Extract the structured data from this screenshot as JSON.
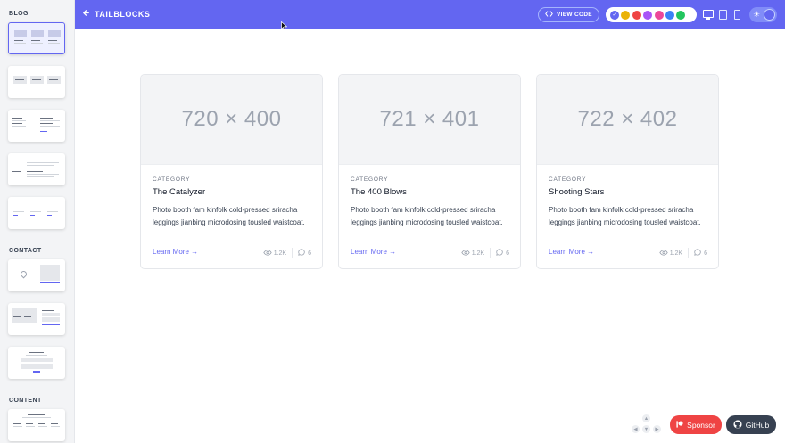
{
  "sidebar": {
    "sections": [
      {
        "title": "BLOG"
      },
      {
        "title": "CONTACT"
      },
      {
        "title": "CONTENT"
      }
    ]
  },
  "header": {
    "brand": "TAILBLOCKS",
    "view_code_label": "VIEW CODE",
    "colors": [
      "#6366f1",
      "#eab308",
      "#ef4444",
      "#a855f7",
      "#ec4899",
      "#3b82f6",
      "#22c55e"
    ]
  },
  "cards": [
    {
      "image_label": "720 × 400",
      "category": "CATEGORY",
      "title": "The Catalyzer",
      "desc": "Photo booth fam kinfolk cold-pressed sriracha leggings jianbing microdosing tousled waistcoat.",
      "link": "Learn More",
      "views": "1.2K",
      "comments": "6"
    },
    {
      "image_label": "721 × 401",
      "category": "CATEGORY",
      "title": "The 400 Blows",
      "desc": "Photo booth fam kinfolk cold-pressed sriracha leggings jianbing microdosing tousled waistcoat.",
      "link": "Learn More",
      "views": "1.2K",
      "comments": "6"
    },
    {
      "image_label": "722 × 402",
      "category": "CATEGORY",
      "title": "Shooting Stars",
      "desc": "Photo booth fam kinfolk cold-pressed sriracha leggings jianbing microdosing tousled waistcoat.",
      "link": "Learn More",
      "views": "1.2K",
      "comments": "6"
    }
  ],
  "footer": {
    "sponsor_label": "Sponsor",
    "github_label": "GitHub"
  }
}
